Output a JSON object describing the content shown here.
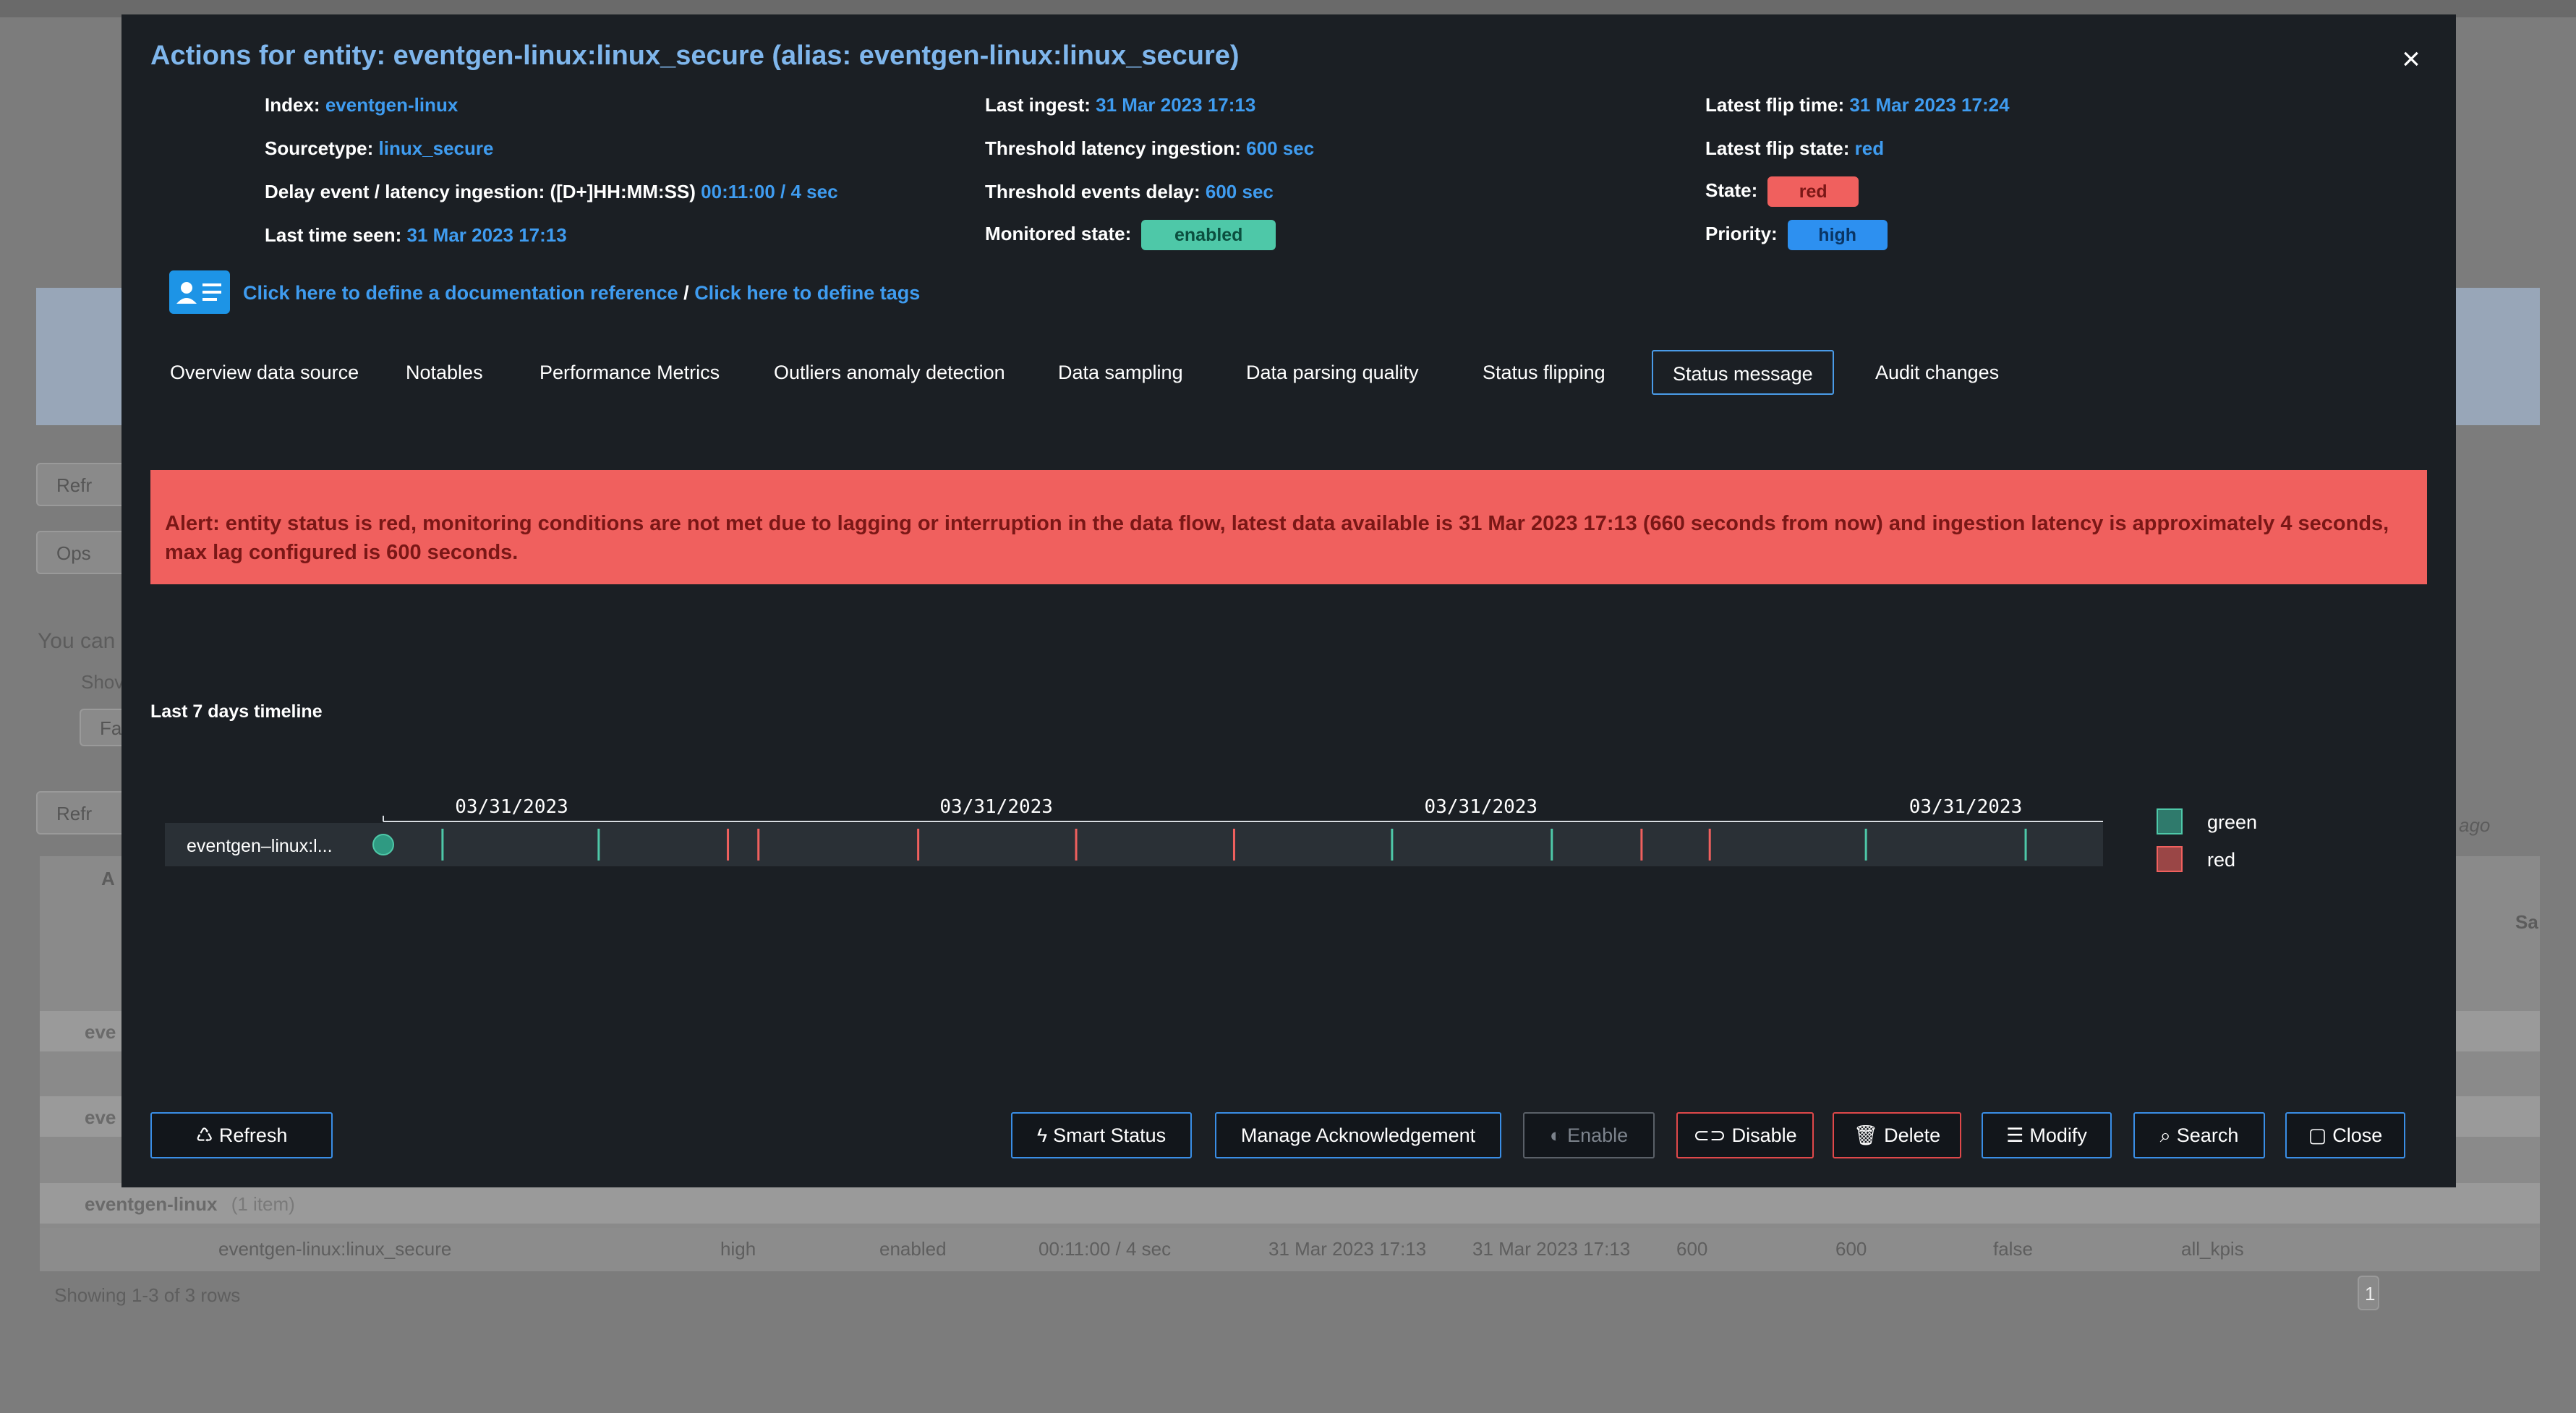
{
  "background": {
    "buttons": [
      "Refr",
      "Ops",
      "Refr"
    ],
    "text_you_can": "You can",
    "text_show": "Shov",
    "text_fa": "Fa",
    "text_ago": "ago",
    "text_sa": "Sa",
    "col_a": "A",
    "groups": [
      "eve",
      "eve",
      "eventgen-linux"
    ],
    "group_count": "(1 item)",
    "row": {
      "name": "eventgen-linux:linux_secure",
      "priority": "high",
      "monitored": "enabled",
      "delay": "00:11:00 / 4 sec",
      "last_time": "31 Mar 2023 17:13",
      "last_ingest": "31 Mar 2023 17:13",
      "thr1": "600",
      "thr2": "600",
      "flag": "false",
      "kpis": "all_kpis"
    },
    "footer": "Showing 1-3 of 3 rows",
    "page": "1"
  },
  "modal": {
    "title": "Actions for entity: eventgen-linux:linux_secure (alias: eventgen-linux:linux_secure)",
    "close_symbol": "×",
    "info": {
      "col1": [
        {
          "label": "Index:",
          "value": "eventgen-linux"
        },
        {
          "label": "Sourcetype:",
          "value": "linux_secure"
        },
        {
          "label": "Delay event / latency ingestion: ([D+]HH:MM:SS)",
          "value": "00:11:00 / 4 sec"
        },
        {
          "label": "Last time seen:",
          "value": "31 Mar 2023 17:13"
        }
      ],
      "col2": [
        {
          "label": "Last ingest:",
          "value": "31 Mar 2023 17:13"
        },
        {
          "label": "Threshold latency ingestion:",
          "value": "600 sec"
        },
        {
          "label": "Threshold events delay:",
          "value": "600 sec"
        },
        {
          "label": "Monitored state:",
          "value": "enabled"
        }
      ],
      "col3": [
        {
          "label": "Latest flip time:",
          "value": "31 Mar 2023 17:24"
        },
        {
          "label": "Latest flip state:",
          "value": "red"
        },
        {
          "label": "State:",
          "value": "red"
        },
        {
          "label": "Priority:",
          "value": "high"
        }
      ]
    },
    "doc_link": "Click here to define a documentation reference",
    "doc_sep": " / ",
    "tags_link": "Click here to define tags",
    "tabs": [
      "Overview data source",
      "Notables",
      "Performance Metrics",
      "Outliers anomaly detection",
      "Data sampling",
      "Data parsing quality",
      "Status flipping",
      "Status message",
      "Audit changes"
    ],
    "active_tab": "Status message",
    "alert": "Alert: entity status is red, monitoring conditions are not met due to lagging or interruption in the data flow, latest data available is 31 Mar 2023 17:13 (660 seconds from now) and ingestion latency is approximately 4 seconds, max lag configured is 600 seconds.",
    "timeline_title": "Last 7 days timeline",
    "buttons": {
      "refresh": "Refresh",
      "smart_status": "Smart Status",
      "manage_ack": "Manage Acknowledgement",
      "enable": "Enable",
      "disable": "Disable",
      "delete": "Delete",
      "modify": "Modify",
      "search": "Search",
      "close": "Close"
    }
  },
  "chart_data": {
    "type": "timeline",
    "row_label": "eventgen–linux:l...",
    "x_ticks": [
      "03/31/2023",
      "03/31/2023",
      "03/31/2023",
      "03/31/2023"
    ],
    "tick_positions": [
      0.04,
      0.31,
      0.58,
      0.85
    ],
    "start_marker": {
      "position": 0.0,
      "state": "green"
    },
    "events": [
      {
        "position": 0.033,
        "state": "green"
      },
      {
        "position": 0.12,
        "state": "green"
      },
      {
        "position": 0.192,
        "state": "red"
      },
      {
        "position": 0.209,
        "state": "red"
      },
      {
        "position": 0.298,
        "state": "red"
      },
      {
        "position": 0.386,
        "state": "red"
      },
      {
        "position": 0.474,
        "state": "red"
      },
      {
        "position": 0.562,
        "state": "green"
      },
      {
        "position": 0.651,
        "state": "green"
      },
      {
        "position": 0.701,
        "state": "red"
      },
      {
        "position": 0.739,
        "state": "red"
      },
      {
        "position": 0.826,
        "state": "green"
      },
      {
        "position": 0.915,
        "state": "green"
      },
      {
        "position": 1.0,
        "state": "red"
      }
    ],
    "legend": [
      {
        "name": "green",
        "color": "#2f7a6c",
        "border": "#4ec8a8"
      },
      {
        "name": "red",
        "color": "#9a4646",
        "border": "#f0605e"
      }
    ],
    "colors": {
      "green": "#4ec8a8",
      "red": "#f0605e"
    }
  }
}
